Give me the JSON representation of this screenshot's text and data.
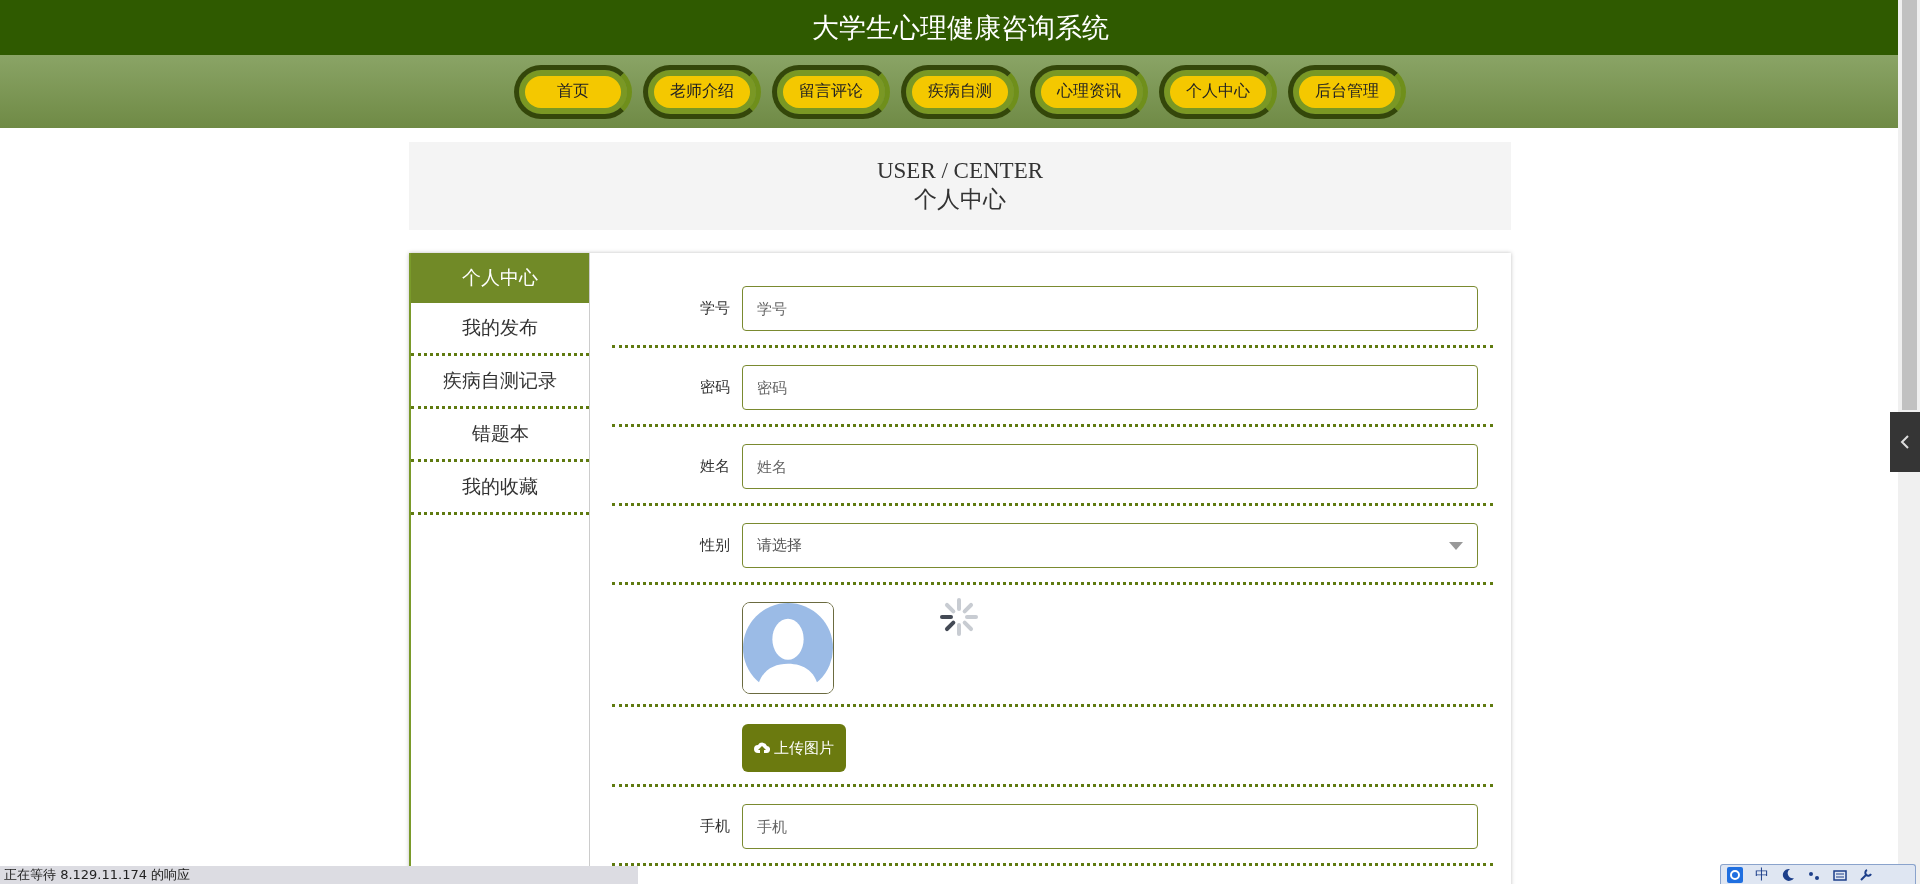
{
  "header": {
    "title": "大学生心理健康咨询系统"
  },
  "nav": [
    "首页",
    "老师介绍",
    "留言评论",
    "疾病自测",
    "心理资讯",
    "个人中心",
    "后台管理"
  ],
  "banner": {
    "title": "USER / CENTER",
    "subtitle": "个人中心"
  },
  "sidebar": {
    "items": [
      {
        "label": "个人中心",
        "selected": true
      },
      {
        "label": "我的发布",
        "selected": false
      },
      {
        "label": "疾病自测记录",
        "selected": false
      },
      {
        "label": "错题本",
        "selected": false
      },
      {
        "label": "我的收藏",
        "selected": false
      }
    ]
  },
  "form": {
    "rows": [
      {
        "kind": "text",
        "label": "学号",
        "placeholder": "学号"
      },
      {
        "kind": "text",
        "label": "密码",
        "placeholder": "密码"
      },
      {
        "kind": "text",
        "label": "姓名",
        "placeholder": "姓名"
      },
      {
        "kind": "select",
        "label": "性别",
        "placeholder": "请选择"
      },
      {
        "kind": "avatar"
      },
      {
        "kind": "upload",
        "button": "上传图片"
      },
      {
        "kind": "text",
        "label": "手机",
        "placeholder": "手机"
      }
    ]
  },
  "status_bar": {
    "text": "正在等待 8.129.11.174 的响应"
  },
  "ime_toolbar": {
    "mode": "中"
  }
}
